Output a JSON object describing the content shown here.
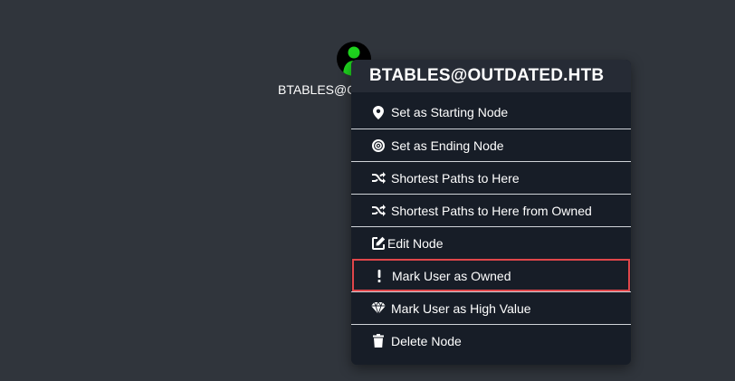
{
  "node": {
    "label": "BTABLES@OUTDATED.HTB",
    "icon": "user-icon",
    "icon_color": "#1ed41e"
  },
  "context_menu": {
    "title": "BTABLES@OUTDATED.HTB",
    "items": [
      {
        "label": "Set as Starting Node",
        "icon": "map-marker-icon"
      },
      {
        "label": "Set as Ending Node",
        "icon": "bullseye-icon"
      },
      {
        "label": "Shortest Paths to Here",
        "icon": "random-icon"
      },
      {
        "label": "Shortest Paths to Here from Owned",
        "icon": "random-icon"
      },
      {
        "label": "Edit Node",
        "icon": "edit-icon"
      },
      {
        "label": "Mark User as Owned",
        "icon": "exclamation-icon",
        "highlighted": true
      },
      {
        "label": "Mark User as High Value",
        "icon": "gem-icon"
      },
      {
        "label": "Delete Node",
        "icon": "trash-icon"
      }
    ]
  },
  "colors": {
    "background": "#30353c",
    "menu_background": "#171d27",
    "menu_header": "#262b35",
    "highlight_border": "#e0464a"
  }
}
